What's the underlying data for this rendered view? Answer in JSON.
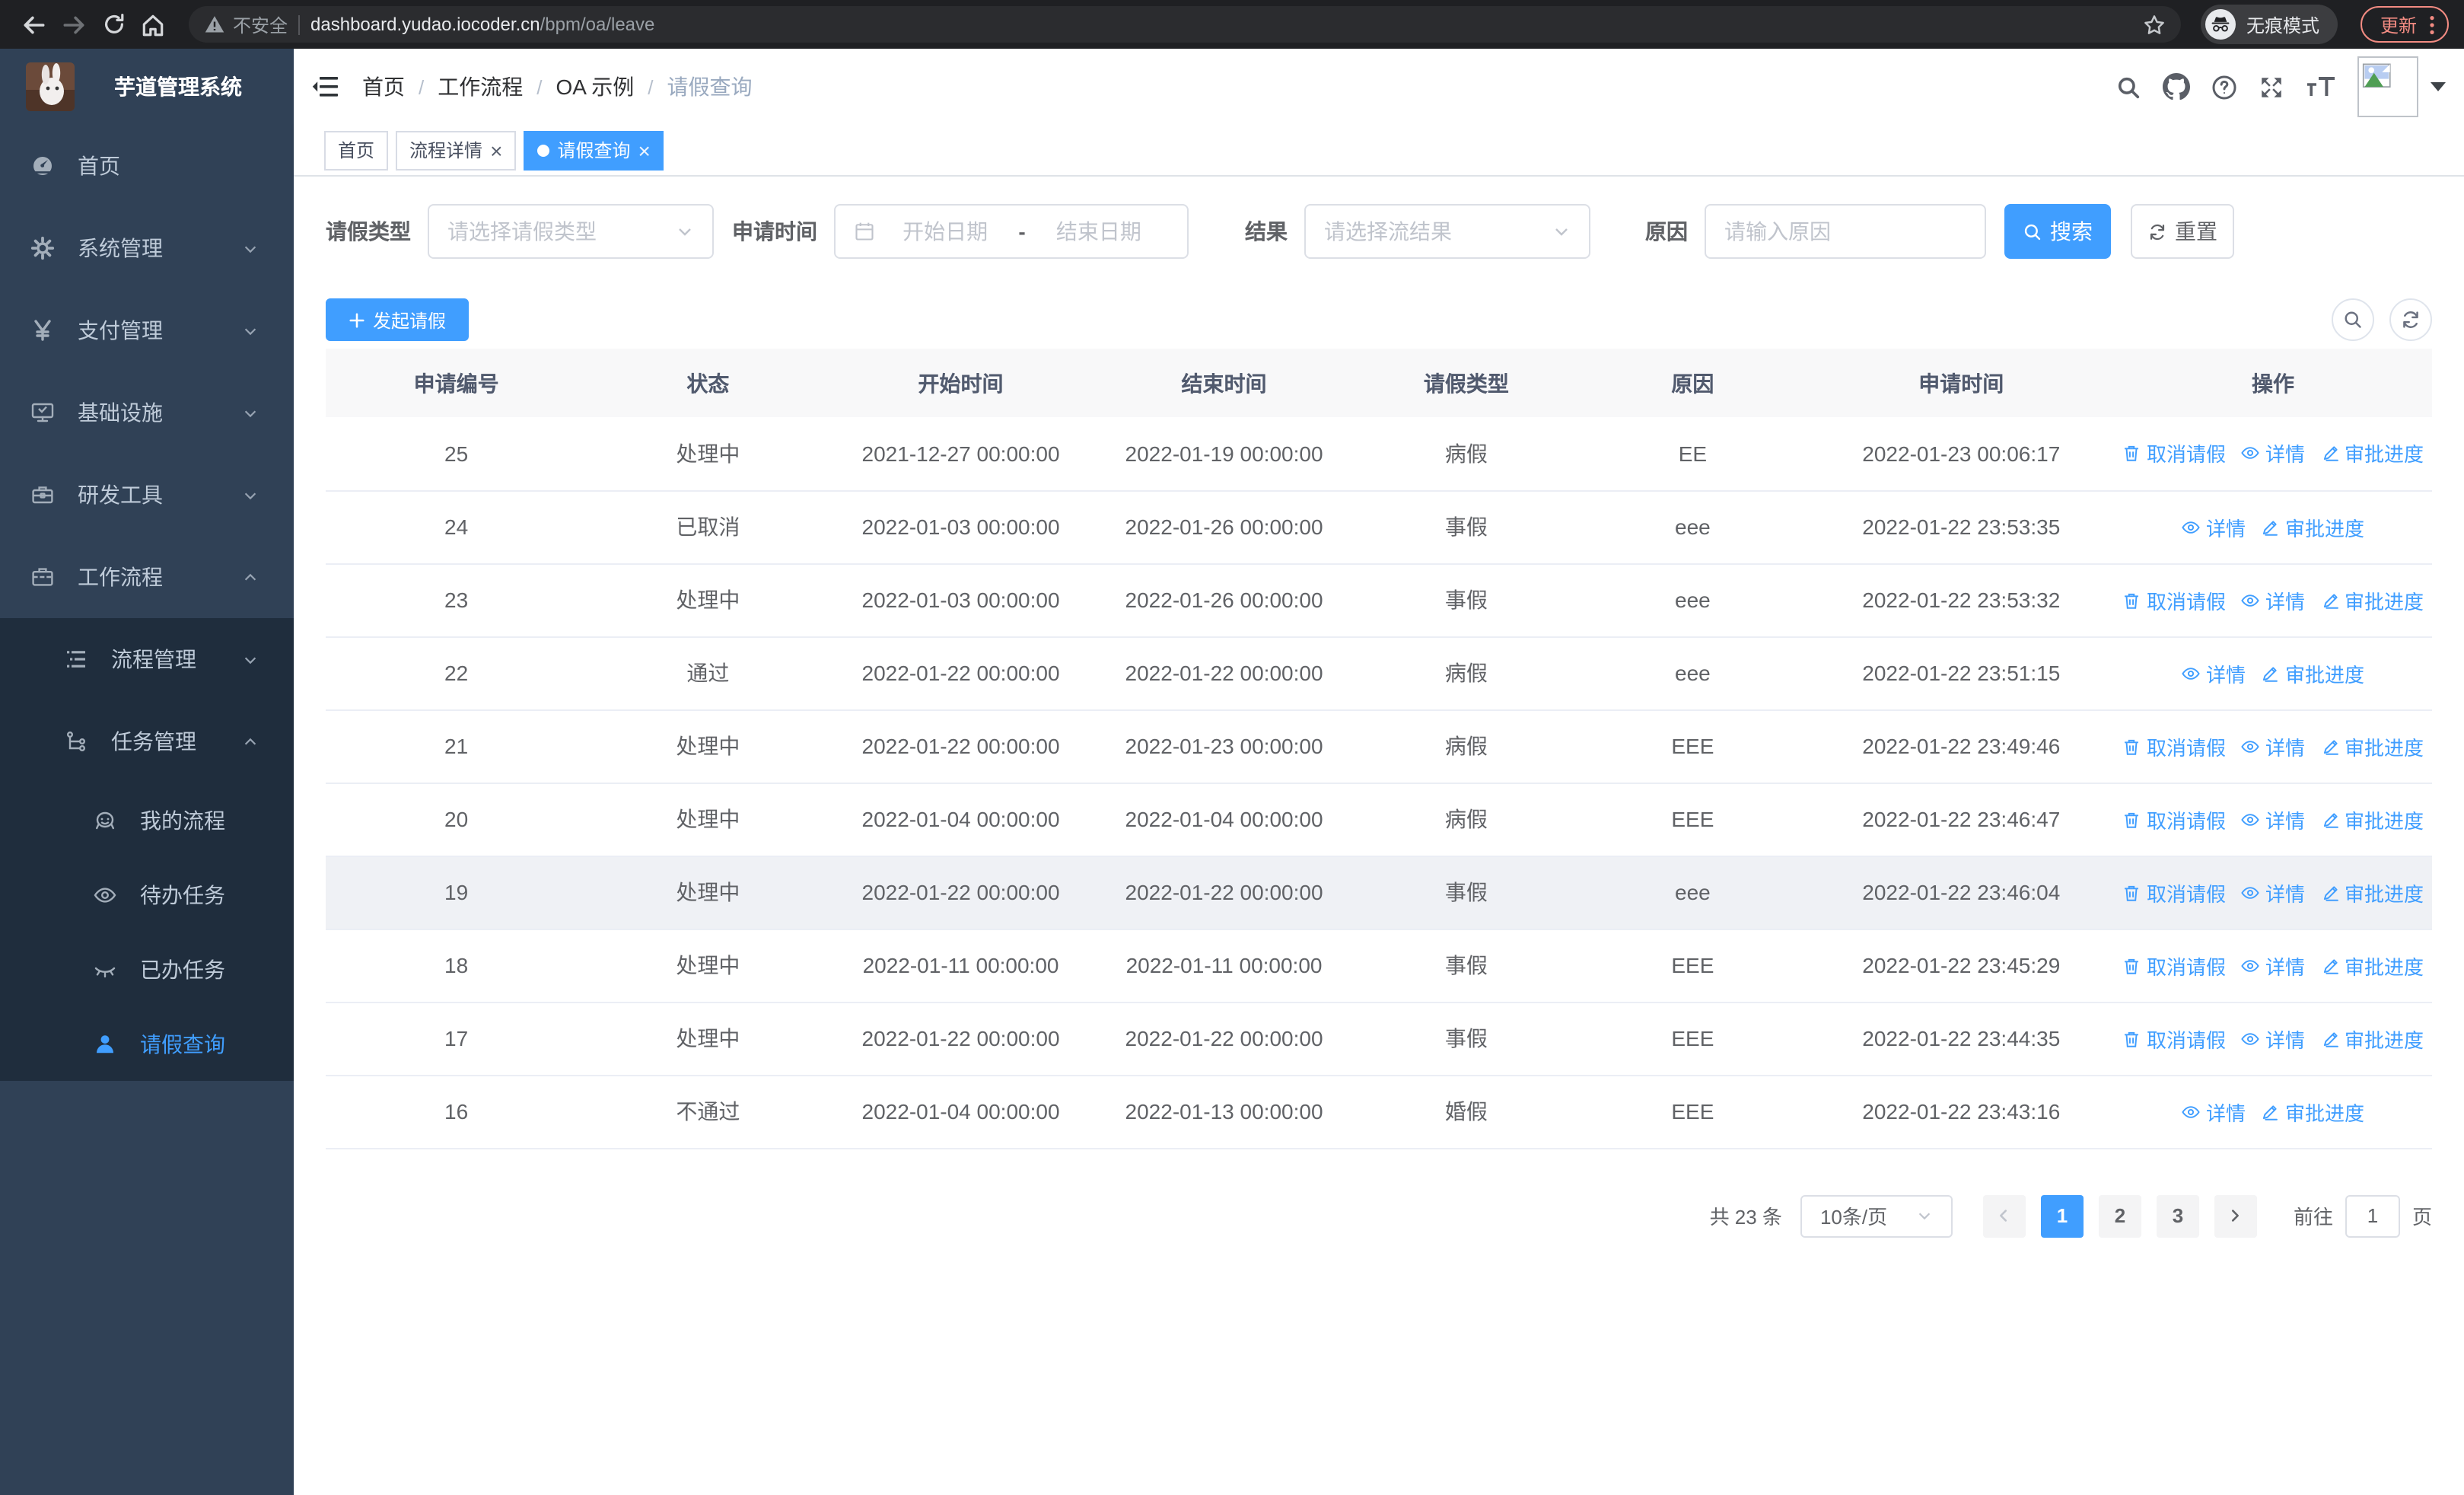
{
  "browser": {
    "security_label": "不安全",
    "url_domain": "dashboard.yudao.iocoder.cn",
    "url_path": "/bpm/oa/leave",
    "incognito_label": "无痕模式",
    "update_label": "更新"
  },
  "app": {
    "logo_title": "芋道管理系统"
  },
  "menu": [
    {
      "key": "home",
      "label": "首页",
      "icon": "dashboard"
    },
    {
      "key": "system",
      "label": "系统管理",
      "icon": "gear",
      "chevron": "down"
    },
    {
      "key": "payment",
      "label": "支付管理",
      "icon": "yen",
      "chevron": "down"
    },
    {
      "key": "infra",
      "label": "基础设施",
      "icon": "monitor",
      "chevron": "down"
    },
    {
      "key": "devtools",
      "label": "研发工具",
      "icon": "toolbox",
      "chevron": "down"
    },
    {
      "key": "workflow",
      "label": "工作流程",
      "icon": "briefcase",
      "chevron": "up",
      "children": [
        {
          "key": "process-mgmt",
          "label": "流程管理",
          "icon": "list",
          "chevron": "down"
        },
        {
          "key": "task-mgmt",
          "label": "任务管理",
          "icon": "tree",
          "chevron": "up",
          "children": [
            {
              "key": "my-process",
              "label": "我的流程",
              "icon": "face"
            },
            {
              "key": "todo-tasks",
              "label": "待办任务",
              "icon": "eye"
            },
            {
              "key": "done-tasks",
              "label": "已办任务",
              "icon": "eye-closed"
            },
            {
              "key": "leave-query",
              "label": "请假查询",
              "icon": "user",
              "active": true
            }
          ]
        }
      ]
    }
  ],
  "breadcrumb": [
    "首页",
    "工作流程",
    "OA 示例",
    "请假查询"
  ],
  "tabs": [
    {
      "key": "home",
      "label": "首页",
      "active": false,
      "closable": false
    },
    {
      "key": "process-detail",
      "label": "流程详情",
      "active": false,
      "closable": true
    },
    {
      "key": "leave-query",
      "label": "请假查询",
      "active": true,
      "closable": true
    }
  ],
  "filter": {
    "type_label": "请假类型",
    "type_placeholder": "请选择请假类型",
    "time_label": "申请时间",
    "start_placeholder": "开始日期",
    "separator": "-",
    "end_placeholder": "结束日期",
    "result_label": "结果",
    "result_placeholder": "请选择流结果",
    "reason_label": "原因",
    "reason_placeholder": "请输入原因",
    "search_label": "搜索",
    "reset_label": "重置"
  },
  "toolbar": {
    "create_label": "发起请假"
  },
  "table": {
    "headers": [
      "申请编号",
      "状态",
      "开始时间",
      "结束时间",
      "请假类型",
      "原因",
      "申请时间",
      "操作"
    ],
    "action_labels": {
      "cancel": "取消请假",
      "detail": "详情",
      "progress": "审批进度"
    },
    "rows": [
      {
        "id": "25",
        "status": "处理中",
        "start": "2021-12-27 00:00:00",
        "end": "2022-01-19 00:00:00",
        "type": "病假",
        "reason": "EE",
        "applied": "2022-01-23 00:06:17",
        "actions": [
          "cancel",
          "detail",
          "progress"
        ]
      },
      {
        "id": "24",
        "status": "已取消",
        "start": "2022-01-03 00:00:00",
        "end": "2022-01-26 00:00:00",
        "type": "事假",
        "reason": "eee",
        "applied": "2022-01-22 23:53:35",
        "actions": [
          "detail",
          "progress"
        ]
      },
      {
        "id": "23",
        "status": "处理中",
        "start": "2022-01-03 00:00:00",
        "end": "2022-01-26 00:00:00",
        "type": "事假",
        "reason": "eee",
        "applied": "2022-01-22 23:53:32",
        "actions": [
          "cancel",
          "detail",
          "progress"
        ]
      },
      {
        "id": "22",
        "status": "通过",
        "start": "2022-01-22 00:00:00",
        "end": "2022-01-22 00:00:00",
        "type": "病假",
        "reason": "eee",
        "applied": "2022-01-22 23:51:15",
        "actions": [
          "detail",
          "progress"
        ]
      },
      {
        "id": "21",
        "status": "处理中",
        "start": "2022-01-22 00:00:00",
        "end": "2022-01-23 00:00:00",
        "type": "病假",
        "reason": "EEE",
        "applied": "2022-01-22 23:49:46",
        "actions": [
          "cancel",
          "detail",
          "progress"
        ]
      },
      {
        "id": "20",
        "status": "处理中",
        "start": "2022-01-04 00:00:00",
        "end": "2022-01-04 00:00:00",
        "type": "病假",
        "reason": "EEE",
        "applied": "2022-01-22 23:46:47",
        "actions": [
          "cancel",
          "detail",
          "progress"
        ]
      },
      {
        "id": "19",
        "status": "处理中",
        "start": "2022-01-22 00:00:00",
        "end": "2022-01-22 00:00:00",
        "type": "事假",
        "reason": "eee",
        "applied": "2022-01-22 23:46:04",
        "actions": [
          "cancel",
          "detail",
          "progress"
        ],
        "highlight": true
      },
      {
        "id": "18",
        "status": "处理中",
        "start": "2022-01-11 00:00:00",
        "end": "2022-01-11 00:00:00",
        "type": "事假",
        "reason": "EEE",
        "applied": "2022-01-22 23:45:29",
        "actions": [
          "cancel",
          "detail",
          "progress"
        ]
      },
      {
        "id": "17",
        "status": "处理中",
        "start": "2022-01-22 00:00:00",
        "end": "2022-01-22 00:00:00",
        "type": "事假",
        "reason": "EEE",
        "applied": "2022-01-22 23:44:35",
        "actions": [
          "cancel",
          "detail",
          "progress"
        ]
      },
      {
        "id": "16",
        "status": "不通过",
        "start": "2022-01-04 00:00:00",
        "end": "2022-01-13 00:00:00",
        "type": "婚假",
        "reason": "EEE",
        "applied": "2022-01-22 23:43:16",
        "actions": [
          "detail",
          "progress"
        ]
      }
    ]
  },
  "pagination": {
    "total": "共 23 条",
    "page_size": "10条/页",
    "pages": [
      "1",
      "2",
      "3"
    ],
    "active": "1",
    "goto_label": "前往",
    "goto_value": "1",
    "unit": "页"
  },
  "colors": {
    "accent": "#409eff",
    "sidebar_bg": "#304156",
    "submenu_bg": "#1f2d3d"
  }
}
